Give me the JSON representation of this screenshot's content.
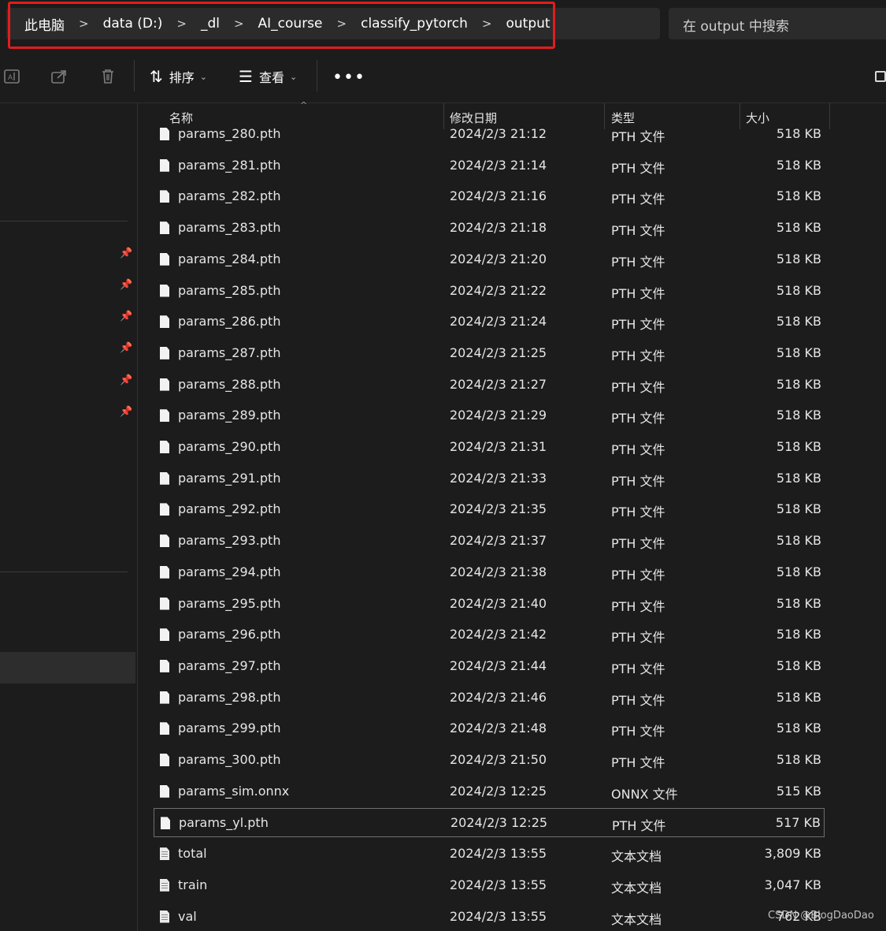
{
  "breadcrumb": [
    "此电脑",
    "data (D:)",
    "_dl",
    "AI_course",
    "classify_pytorch",
    "output"
  ],
  "search": {
    "placeholder": "在 output 中搜索"
  },
  "toolbar": {
    "sort_label": "排序",
    "view_label": "查看",
    "icons": [
      "rename-icon",
      "share-icon",
      "delete-icon",
      "sort-icon",
      "view-icon",
      "more-icon"
    ]
  },
  "columns": {
    "name": "名称",
    "date": "修改日期",
    "type": "类型",
    "size": "大小"
  },
  "files": [
    {
      "name": "params_280.pth",
      "date": "2024/2/3 21:12",
      "type": "PTH 文件",
      "size": "518 KB",
      "icon": "file"
    },
    {
      "name": "params_281.pth",
      "date": "2024/2/3 21:14",
      "type": "PTH 文件",
      "size": "518 KB",
      "icon": "file"
    },
    {
      "name": "params_282.pth",
      "date": "2024/2/3 21:16",
      "type": "PTH 文件",
      "size": "518 KB",
      "icon": "file"
    },
    {
      "name": "params_283.pth",
      "date": "2024/2/3 21:18",
      "type": "PTH 文件",
      "size": "518 KB",
      "icon": "file"
    },
    {
      "name": "params_284.pth",
      "date": "2024/2/3 21:20",
      "type": "PTH 文件",
      "size": "518 KB",
      "icon": "file"
    },
    {
      "name": "params_285.pth",
      "date": "2024/2/3 21:22",
      "type": "PTH 文件",
      "size": "518 KB",
      "icon": "file"
    },
    {
      "name": "params_286.pth",
      "date": "2024/2/3 21:24",
      "type": "PTH 文件",
      "size": "518 KB",
      "icon": "file"
    },
    {
      "name": "params_287.pth",
      "date": "2024/2/3 21:25",
      "type": "PTH 文件",
      "size": "518 KB",
      "icon": "file"
    },
    {
      "name": "params_288.pth",
      "date": "2024/2/3 21:27",
      "type": "PTH 文件",
      "size": "518 KB",
      "icon": "file"
    },
    {
      "name": "params_289.pth",
      "date": "2024/2/3 21:29",
      "type": "PTH 文件",
      "size": "518 KB",
      "icon": "file"
    },
    {
      "name": "params_290.pth",
      "date": "2024/2/3 21:31",
      "type": "PTH 文件",
      "size": "518 KB",
      "icon": "file"
    },
    {
      "name": "params_291.pth",
      "date": "2024/2/3 21:33",
      "type": "PTH 文件",
      "size": "518 KB",
      "icon": "file"
    },
    {
      "name": "params_292.pth",
      "date": "2024/2/3 21:35",
      "type": "PTH 文件",
      "size": "518 KB",
      "icon": "file"
    },
    {
      "name": "params_293.pth",
      "date": "2024/2/3 21:37",
      "type": "PTH 文件",
      "size": "518 KB",
      "icon": "file"
    },
    {
      "name": "params_294.pth",
      "date": "2024/2/3 21:38",
      "type": "PTH 文件",
      "size": "518 KB",
      "icon": "file"
    },
    {
      "name": "params_295.pth",
      "date": "2024/2/3 21:40",
      "type": "PTH 文件",
      "size": "518 KB",
      "icon": "file"
    },
    {
      "name": "params_296.pth",
      "date": "2024/2/3 21:42",
      "type": "PTH 文件",
      "size": "518 KB",
      "icon": "file"
    },
    {
      "name": "params_297.pth",
      "date": "2024/2/3 21:44",
      "type": "PTH 文件",
      "size": "518 KB",
      "icon": "file"
    },
    {
      "name": "params_298.pth",
      "date": "2024/2/3 21:46",
      "type": "PTH 文件",
      "size": "518 KB",
      "icon": "file"
    },
    {
      "name": "params_299.pth",
      "date": "2024/2/3 21:48",
      "type": "PTH 文件",
      "size": "518 KB",
      "icon": "file"
    },
    {
      "name": "params_300.pth",
      "date": "2024/2/3 21:50",
      "type": "PTH 文件",
      "size": "518 KB",
      "icon": "file"
    },
    {
      "name": "params_sim.onnx",
      "date": "2024/2/3 12:25",
      "type": "ONNX 文件",
      "size": "515 KB",
      "icon": "file"
    },
    {
      "name": "params_yl.pth",
      "date": "2024/2/3 12:25",
      "type": "PTH 文件",
      "size": "517 KB",
      "icon": "file",
      "selected": true
    },
    {
      "name": "total",
      "date": "2024/2/3 13:55",
      "type": "文本文档",
      "size": "3,809 KB",
      "icon": "text"
    },
    {
      "name": "train",
      "date": "2024/2/3 13:55",
      "type": "文本文档",
      "size": "3,047 KB",
      "icon": "text"
    },
    {
      "name": "val",
      "date": "2024/2/3 13:55",
      "type": "文本文档",
      "size": "762 KB",
      "icon": "text"
    }
  ],
  "watermark": "CSDN @BlogDaoDao",
  "colors": {
    "highlight": "#e11d1d",
    "background": "#1c1c1c"
  }
}
